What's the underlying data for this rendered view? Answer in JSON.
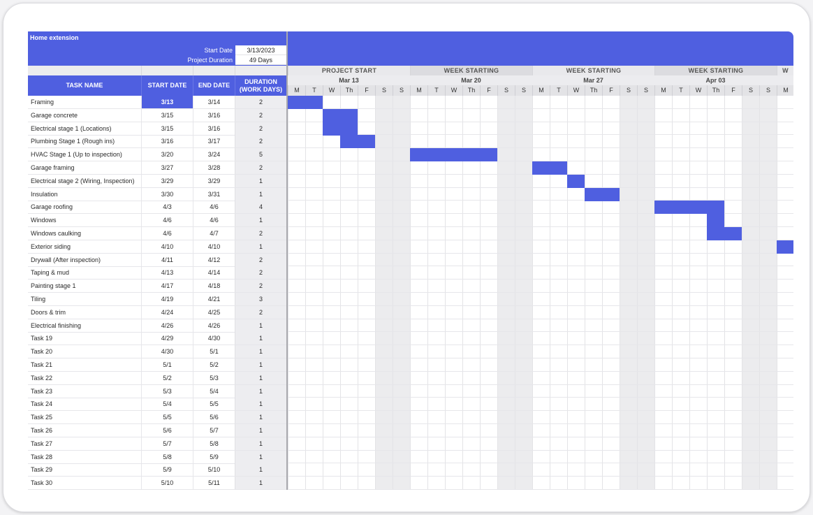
{
  "project": {
    "title": "Home extension",
    "start_label": "Start Date",
    "start_value": "3/13/2023",
    "duration_label": "Project Duration",
    "duration_value": "49 Days"
  },
  "columns": {
    "task": "TASK NAME",
    "start": "START DATE",
    "end": "END DATE",
    "duration": "DURATION\n(WORK DAYS)"
  },
  "timeline": {
    "weeks": [
      {
        "label": "PROJECT START",
        "date": "Mar 13"
      },
      {
        "label": "WEEK STARTING",
        "date": "Mar 20"
      },
      {
        "label": "WEEK STARTING",
        "date": "Mar 27"
      },
      {
        "label": "WEEK STARTING",
        "date": "Apr 03"
      },
      {
        "label": "W",
        "date": ""
      }
    ],
    "days": [
      "M",
      "T",
      "W",
      "Th",
      "F",
      "S",
      "S"
    ],
    "bar_color": "#4f5fe0"
  },
  "tasks": [
    {
      "name": "Framing",
      "start": "3/13",
      "end": "3/14",
      "duration": "2"
    },
    {
      "name": "Garage concrete",
      "start": "3/15",
      "end": "3/16",
      "duration": "2"
    },
    {
      "name": "Electrical stage 1 (Locations)",
      "start": "3/15",
      "end": "3/16",
      "duration": "2"
    },
    {
      "name": "Plumbing Stage 1 (Rough ins)",
      "start": "3/16",
      "end": "3/17",
      "duration": "2"
    },
    {
      "name": "HVAC Stage 1 (Up to inspection)",
      "start": "3/20",
      "end": "3/24",
      "duration": "5"
    },
    {
      "name": "Garage framing",
      "start": "3/27",
      "end": "3/28",
      "duration": "2"
    },
    {
      "name": "Electrical stage 2 (Wiring, Inspection)",
      "start": "3/29",
      "end": "3/29",
      "duration": "1"
    },
    {
      "name": "Insulation",
      "start": "3/30",
      "end": "3/31",
      "duration": "1"
    },
    {
      "name": "Garage roofing",
      "start": "4/3",
      "end": "4/6",
      "duration": "4"
    },
    {
      "name": "Windows",
      "start": "4/6",
      "end": "4/6",
      "duration": "1"
    },
    {
      "name": "Windows caulking",
      "start": "4/6",
      "end": "4/7",
      "duration": "2"
    },
    {
      "name": "Exterior siding",
      "start": "4/10",
      "end": "4/10",
      "duration": "1"
    },
    {
      "name": "Drywall (After inspection)",
      "start": "4/11",
      "end": "4/12",
      "duration": "2"
    },
    {
      "name": "Taping & mud",
      "start": "4/13",
      "end": "4/14",
      "duration": "2"
    },
    {
      "name": "Painting stage 1",
      "start": "4/17",
      "end": "4/18",
      "duration": "2"
    },
    {
      "name": "Tiling",
      "start": "4/19",
      "end": "4/21",
      "duration": "3"
    },
    {
      "name": "Doors & trim",
      "start": "4/24",
      "end": "4/25",
      "duration": "2"
    },
    {
      "name": "Electrical finishing",
      "start": "4/26",
      "end": "4/26",
      "duration": "1"
    },
    {
      "name": "Task 19",
      "start": "4/29",
      "end": "4/30",
      "duration": "1"
    },
    {
      "name": "Task 20",
      "start": "4/30",
      "end": "5/1",
      "duration": "1"
    },
    {
      "name": "Task 21",
      "start": "5/1",
      "end": "5/2",
      "duration": "1"
    },
    {
      "name": "Task 22",
      "start": "5/2",
      "end": "5/3",
      "duration": "1"
    },
    {
      "name": "Task 23",
      "start": "5/3",
      "end": "5/4",
      "duration": "1"
    },
    {
      "name": "Task 24",
      "start": "5/4",
      "end": "5/5",
      "duration": "1"
    },
    {
      "name": "Task 25",
      "start": "5/5",
      "end": "5/6",
      "duration": "1"
    },
    {
      "name": "Task 26",
      "start": "5/6",
      "end": "5/7",
      "duration": "1"
    },
    {
      "name": "Task 27",
      "start": "5/7",
      "end": "5/8",
      "duration": "1"
    },
    {
      "name": "Task 28",
      "start": "5/8",
      "end": "5/9",
      "duration": "1"
    },
    {
      "name": "Task 29",
      "start": "5/9",
      "end": "5/10",
      "duration": "1"
    },
    {
      "name": "Task 30",
      "start": "5/10",
      "end": "5/11",
      "duration": "1"
    }
  ],
  "gantt_bars": [
    {
      "row": 0,
      "from": "3/13",
      "to": "3/14"
    },
    {
      "row": 1,
      "from": "3/15",
      "to": "3/16"
    },
    {
      "row": 2,
      "from": "3/15",
      "to": "3/16"
    },
    {
      "row": 3,
      "from": "3/16",
      "to": "3/17"
    },
    {
      "row": 4,
      "from": "3/20",
      "to": "3/24"
    },
    {
      "row": 5,
      "from": "3/27",
      "to": "3/28"
    },
    {
      "row": 6,
      "from": "3/29",
      "to": "3/29"
    },
    {
      "row": 7,
      "from": "3/30",
      "to": "3/31"
    },
    {
      "row": 8,
      "from": "4/3",
      "to": "4/6"
    },
    {
      "row": 9,
      "from": "4/6",
      "to": "4/6"
    },
    {
      "row": 10,
      "from": "4/6",
      "to": "4/7"
    },
    {
      "row": 11,
      "from": "4/10",
      "to": "4/10"
    }
  ]
}
